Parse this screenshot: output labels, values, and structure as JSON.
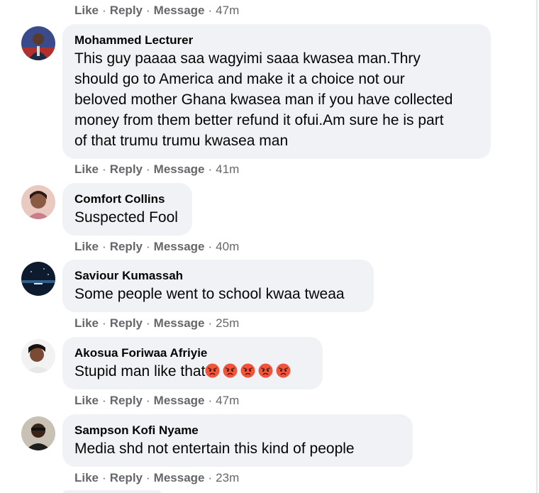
{
  "actions": {
    "like": "Like",
    "reply": "Reply",
    "message": "Message",
    "separator": "·"
  },
  "top_row": {
    "time": "47m"
  },
  "comments": [
    {
      "author": "Mohammed Lecturer",
      "text": "This guy paaaa saa wagyimi saaa kwasea man.Thry\nshould go to America and make it a choice not our\nbeloved mother Ghana kwasea man if you have collected\nmoney from them better refund it ofui.Am sure he is part\nof that trumu trumu kwasea man",
      "time": "41m"
    },
    {
      "author": "Comfort Collins",
      "text": "Suspected Fool",
      "time": "40m"
    },
    {
      "author": "Saviour Kumassah",
      "text": "Some people went to school kwaa tweaa",
      "time": "25m"
    },
    {
      "author": "Akosua Foriwaa Afriyie",
      "text": "Stupid man like that",
      "emoji": "angry-face",
      "emoji_count": 5,
      "time": "47m"
    },
    {
      "author": "Sampson Kofi Nyame",
      "text": "Media shd not entertain this kind of people",
      "time": "23m"
    }
  ],
  "colors": {
    "bubble": "#f0f2f5",
    "meta_text": "#65676b",
    "body_text": "#050505",
    "angry_emoji": "#f0553c"
  }
}
